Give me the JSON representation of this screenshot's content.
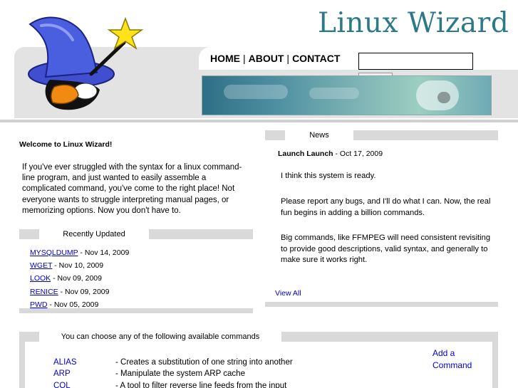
{
  "site": {
    "logo_text": "Linux Wizard"
  },
  "nav": {
    "items": [
      {
        "label": "HOME"
      },
      {
        "label": "ABOUT"
      },
      {
        "label": "CONTACT"
      }
    ],
    "separator": "|"
  },
  "search": {
    "value": "",
    "placeholder": ""
  },
  "welcome": {
    "title": "Welcome to Linux Wizard!",
    "text": "If you've ever struggled with the syntax for a linux command-line program, and just wanted to easily assemble a complicated command, you've come to the right place! Not everyone wants to struggle interpreting manual pages, or memorizing options. Now you don't have to."
  },
  "recently_updated": {
    "heading": "Recently Updated",
    "items": [
      {
        "name": "MYSQLDUMP",
        "date": " - Nov 14, 2009"
      },
      {
        "name": "WGET",
        "date": " - Nov 10, 2009"
      },
      {
        "name": "LOOK",
        "date": " - Nov 09, 2009"
      },
      {
        "name": "RENICE",
        "date": " - Nov 09, 2009"
      },
      {
        "name": "PWD",
        "date": " - Nov 05, 2009"
      }
    ]
  },
  "news": {
    "heading": "News",
    "post_title": "Launch Launch",
    "post_date": " - Oct 17, 2009",
    "paragraphs": [
      "I think this system is ready.",
      "Please report any bugs, and I'll do what I can. Now, the real fun begins in adding a billion commands.",
      "Big commands, like FFMPEG will need consistent revisiting to provide good descriptions, valid syntax, and generally to make sure it works right."
    ],
    "view_all": "View All"
  },
  "commands": {
    "heading": "You can choose any of the following available commands",
    "add_command": "Add a Command",
    "items": [
      {
        "name": "ALIAS",
        "desc": "- Creates a substitution of one string into another"
      },
      {
        "name": "ARP",
        "desc": "- Manipulate the system ARP cache"
      },
      {
        "name": "COL",
        "desc": "- A tool to filter reverse line feeds from the input"
      }
    ]
  },
  "colors": {
    "logo": "#2d7a86",
    "link": "#0000cc",
    "panel_gray": "#d9d9d9",
    "header_gray": "#e3e3e3"
  },
  "icons": {
    "logo_image": "wizard-penguin-icon"
  }
}
